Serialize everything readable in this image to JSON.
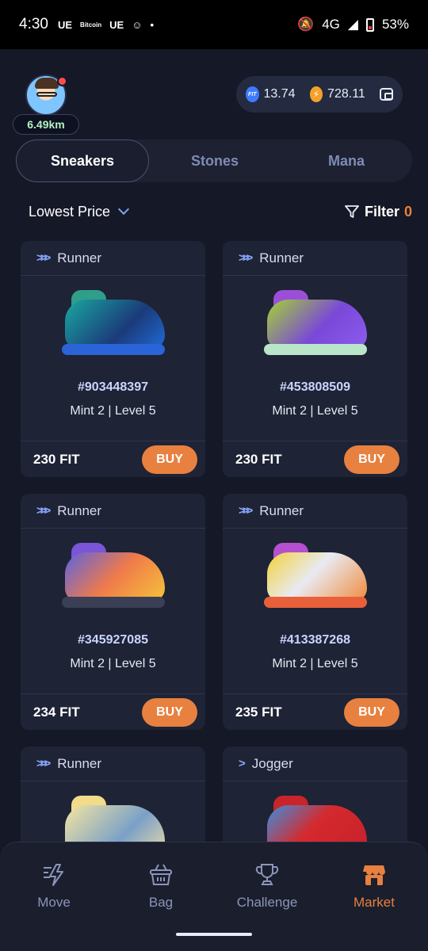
{
  "status": {
    "time": "4:30",
    "items": [
      "UE",
      "Bitcoin",
      "UE"
    ],
    "network": "4G",
    "battery": "53%"
  },
  "profile": {
    "distance": "6.49km"
  },
  "wallet": {
    "fit": "13.74",
    "energy": "728.11"
  },
  "tabs": [
    "Sneakers",
    "Stones",
    "Mana"
  ],
  "active_tab": "Sneakers",
  "sort": {
    "label": "Lowest Price"
  },
  "filter": {
    "label": "Filter",
    "count": "0"
  },
  "cards": [
    {
      "type": "Runner",
      "id": "#903448397",
      "meta": "Mint 2 | Level 5",
      "price": "230 FIT",
      "buy": "BUY"
    },
    {
      "type": "Runner",
      "id": "#453808509",
      "meta": "Mint 2 | Level 5",
      "price": "230 FIT",
      "buy": "BUY"
    },
    {
      "type": "Runner",
      "id": "#345927085",
      "meta": "Mint 2 | Level 5",
      "price": "234 FIT",
      "buy": "BUY"
    },
    {
      "type": "Runner",
      "id": "#413387268",
      "meta": "Mint 2 | Level 5",
      "price": "235 FIT",
      "buy": "BUY"
    },
    {
      "type": "Runner"
    },
    {
      "type": "Jogger"
    }
  ],
  "nav": [
    "Move",
    "Bag",
    "Challenge",
    "Market"
  ],
  "active_nav": "Market",
  "colors": {
    "accent": "#e8803f",
    "bg": "#151826",
    "card": "#1e2335"
  }
}
